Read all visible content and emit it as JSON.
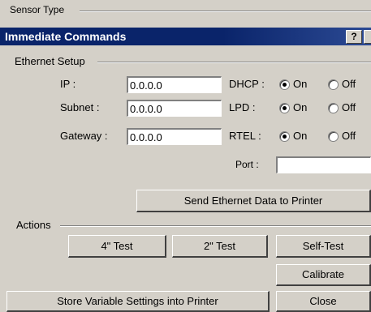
{
  "sensor_type": {
    "label": "Sensor Type"
  },
  "dialog": {
    "title": "Immediate Commands",
    "help_label": "?"
  },
  "ethernet": {
    "group_label": "Ethernet Setup",
    "ip": {
      "label": "IP :",
      "value": "0.0.0.0"
    },
    "subnet": {
      "label": "Subnet :",
      "value": "0.0.0.0"
    },
    "gateway": {
      "label": "Gateway :",
      "value": "0.0.0.0"
    },
    "dhcp": {
      "label": "DHCP :",
      "on_label": "On",
      "off_label": "Off",
      "selected": "On"
    },
    "lpd": {
      "label": "LPD :",
      "on_label": "On",
      "off_label": "Off",
      "selected": "On"
    },
    "rtel": {
      "label": "RTEL :",
      "on_label": "On",
      "off_label": "Off",
      "selected": "On"
    },
    "port": {
      "label": "Port :",
      "value": ""
    },
    "send_button": "Send Ethernet Data to Printer"
  },
  "actions": {
    "group_label": "Actions",
    "test4_button": "4\" Test",
    "test2_button": "2\" Test",
    "selftest_button": "Self-Test",
    "calibrate_button": "Calibrate",
    "store_button": "Store Variable Settings into Printer",
    "close_button": "Close"
  }
}
